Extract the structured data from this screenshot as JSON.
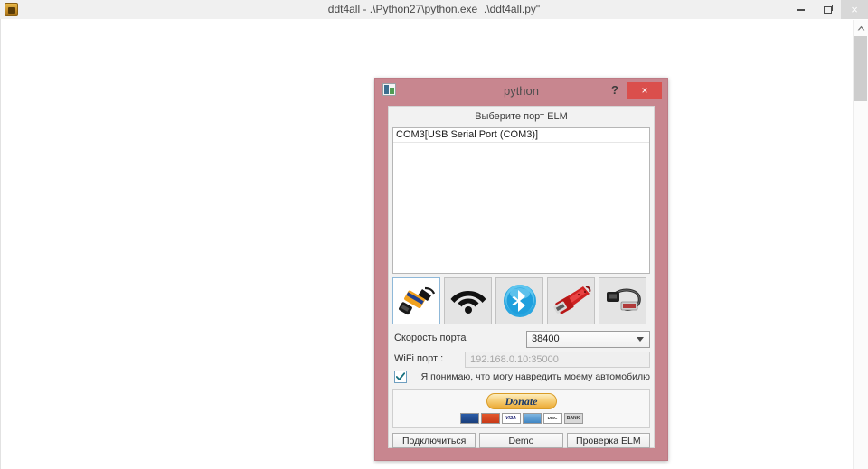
{
  "main_window": {
    "title": "ddt4all - .\\Python27\\python.exe  .\\ddt4all.py\"",
    "icon": "app-icon",
    "controls": {
      "minimize": "minimize-icon",
      "restore": "restore-icon",
      "close": "×"
    },
    "scrollbar": {
      "up_arrow": "chevron-up-icon"
    }
  },
  "dialog": {
    "title": "python",
    "icon": "python-window-icon",
    "help_label": "?",
    "close_label": "×",
    "section_label": "Выберите порт ELM",
    "port_list": [
      "COM3[USB Serial Port (COM3)]"
    ],
    "adapters": [
      {
        "name": "usb-elm-adapter-icon",
        "label": "USB ELM",
        "selected": true
      },
      {
        "name": "wifi-icon",
        "label": "WiFi",
        "selected": false
      },
      {
        "name": "bluetooth-icon",
        "label": "Bluetooth",
        "selected": false
      },
      {
        "name": "red-elm-cable-icon",
        "label": "ELM cable",
        "selected": false
      },
      {
        "name": "gray-cable-icon",
        "label": "Cable",
        "selected": false
      }
    ],
    "speed": {
      "label": "Скорость порта",
      "value": "38400",
      "options": [
        "38400"
      ]
    },
    "wifi": {
      "label": "WiFi порт :",
      "value": "",
      "placeholder": "192.168.0.10:35000"
    },
    "agreement": {
      "checked": true,
      "label": "Я понимаю, что могу навредить моему автомобилю"
    },
    "donate": {
      "label": "Donate",
      "payment_methods": [
        {
          "name": "mastercard-badge",
          "text": "MC"
        },
        {
          "name": "maestro-badge",
          "text": ""
        },
        {
          "name": "visa-badge",
          "text": "VISA"
        },
        {
          "name": "amex-badge",
          "text": ""
        },
        {
          "name": "discover-badge",
          "text": "DISC"
        },
        {
          "name": "bank-badge",
          "text": "BANK"
        }
      ]
    },
    "buttons": [
      {
        "name": "connect-button",
        "label": "Подключиться"
      },
      {
        "name": "demo-button",
        "label": "Demo"
      },
      {
        "name": "check-elm-button",
        "label": "Проверка ELM"
      }
    ]
  },
  "colors": {
    "dialog_frame": "#c8868f",
    "close_red": "#da4f4c",
    "bluetooth_blue": "#2aa6e0",
    "donate_gold": "#eba933"
  }
}
